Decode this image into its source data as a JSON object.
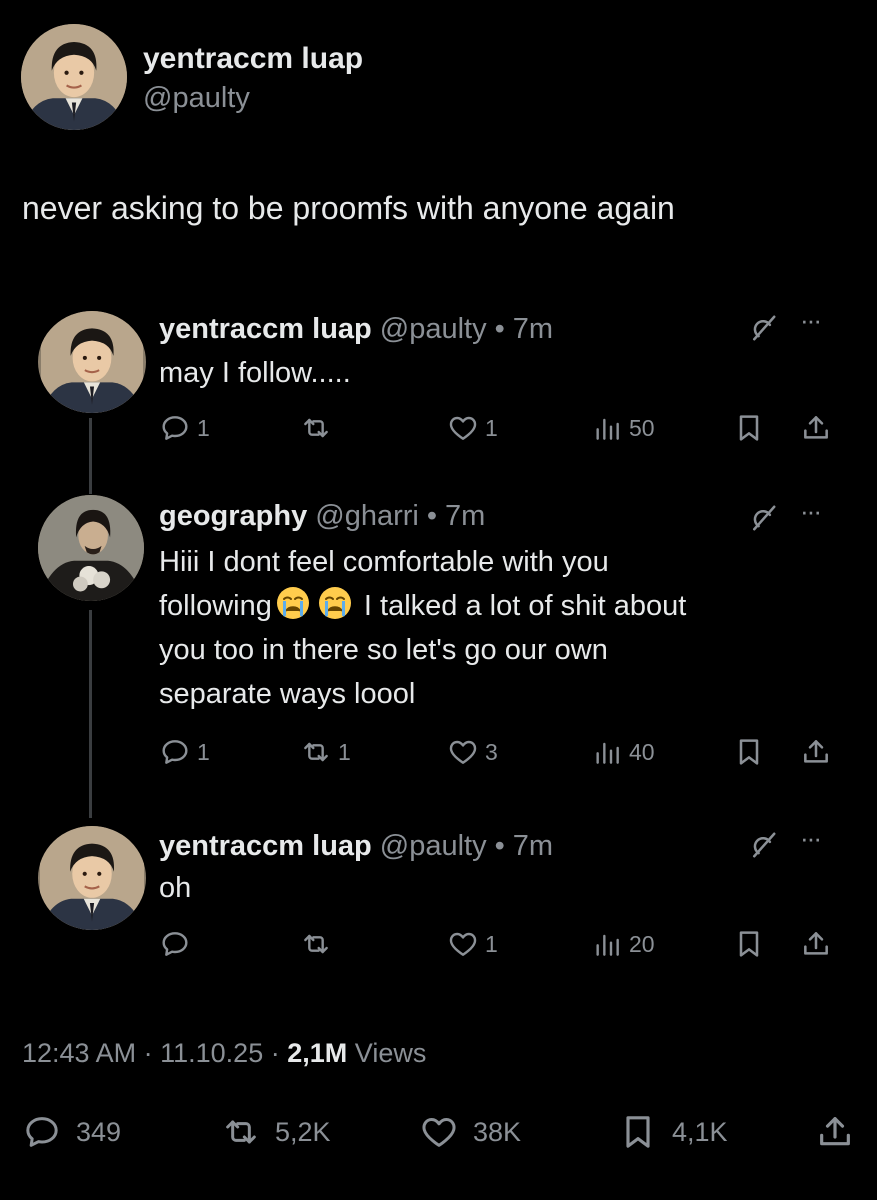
{
  "post": {
    "author_name": "yentraccm luap",
    "author_handle": "@paulty",
    "text": "never asking to be proomfs with anyone again",
    "timestamp": "12:43 AM",
    "date": "11.10.25",
    "views_count": "2,1M",
    "views_label": "Views",
    "separator": "·",
    "stats": {
      "replies": "349",
      "reposts": "5,2K",
      "likes": "38K",
      "bookmarks": "4,1K"
    }
  },
  "replies": [
    {
      "name": "yentraccm luap",
      "handle": "@paulty",
      "time": "• 7m",
      "text": "may I follow.....",
      "replies": "1",
      "reposts": "",
      "likes": "1",
      "views": "50"
    },
    {
      "name": "geography",
      "handle": "@gharri",
      "time": "• 7m",
      "text_lines": [
        "Hiii I dont feel comfortable with you",
        "following",
        "I talked a lot of shit about",
        "you too in there so let's go our own",
        "separate ways loool"
      ],
      "replies": "1",
      "reposts": "1",
      "likes": "3",
      "views": "40"
    },
    {
      "name": "yentraccm luap",
      "handle": "@paulty",
      "time": "• 7m",
      "text": "oh",
      "replies": "",
      "reposts": "",
      "likes": "1",
      "views": "20"
    }
  ],
  "icons": {
    "reply": "speech-bubble-icon",
    "repost": "repost-arrows-icon",
    "like": "heart-icon",
    "views": "bar-chart-icon",
    "bookmark": "bookmark-icon",
    "share": "share-upload-icon",
    "grok": "grok-slash-icon",
    "more": "ellipsis-icon",
    "emoji": "loudly-crying-face-emoji"
  },
  "colors": {
    "background": "#000000",
    "text": "#e7e9ea",
    "muted": "#8b9096",
    "thread_line": "#3a3d40"
  }
}
